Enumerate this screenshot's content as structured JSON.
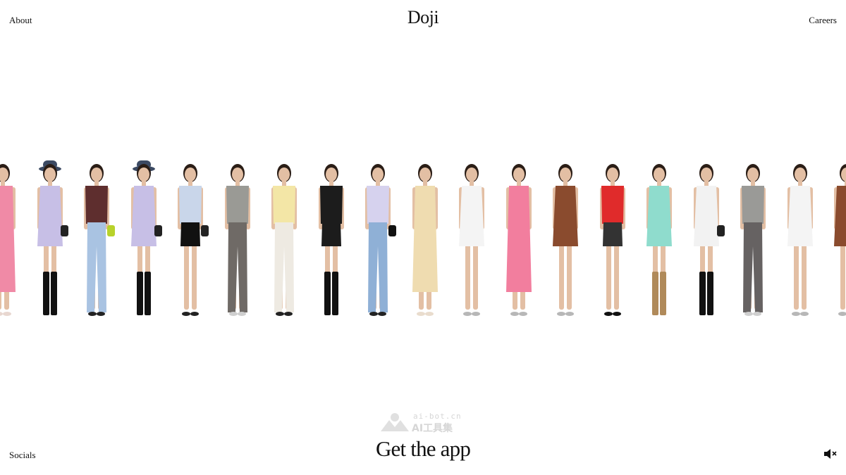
{
  "header": {
    "about_label": "About",
    "logo_text": "Doji",
    "careers_label": "Careers"
  },
  "footer": {
    "socials_label": "Socials",
    "cta_label": "Get the app",
    "mute_icon": "speaker-muted-icon"
  },
  "watermark": {
    "url": "ai-bot.cn",
    "name": "AI工具集"
  },
  "colors": {
    "background": "#ffffff",
    "text": "#111111",
    "skin": "#e3bfa4",
    "hair": "#2a1d16"
  },
  "runway": {
    "models": [
      {
        "name": "model-pink-dress-partial",
        "top": "#f08aa6",
        "bottom": "#f08aa6",
        "shoes": "#e8d7d0",
        "hat": "",
        "bag": "",
        "long_bottom": true,
        "dress": true
      },
      {
        "name": "model-lavender-dress-bucket-hat",
        "top": "#c7bfe6",
        "bottom": "#c7bfe6",
        "shoes": "#111111",
        "hat": "#3c4a63",
        "bag": "#222222",
        "long_bottom": false,
        "dress": true,
        "boots": true
      },
      {
        "name": "model-corset-jeans",
        "top": "#5e2e2e",
        "bottom": "#a9c3e2",
        "shoes": "#222222",
        "hat": "",
        "bag": "#b8d22a",
        "long_bottom": true,
        "dress": false
      },
      {
        "name": "model-lavender-dress-bucket-hat-2",
        "top": "#c7bfe6",
        "bottom": "#c7bfe6",
        "shoes": "#111111",
        "hat": "#3c4a63",
        "bag": "#222222",
        "long_bottom": false,
        "dress": true,
        "boots": true
      },
      {
        "name": "model-blue-shirt-black-shorts",
        "top": "#c9d6ea",
        "bottom": "#111111",
        "shoes": "#222222",
        "hat": "",
        "bag": "#222222",
        "long_bottom": false,
        "dress": false
      },
      {
        "name": "model-grey-top-grey-pants",
        "top": "#9a9a95",
        "bottom": "#6f6a66",
        "shoes": "#cfcfcf",
        "hat": "",
        "bag": "",
        "long_bottom": true,
        "dress": false
      },
      {
        "name": "model-yellow-top-white-pants",
        "top": "#f3e6a6",
        "bottom": "#eeeae2",
        "shoes": "#222222",
        "hat": "",
        "bag": "",
        "long_bottom": true,
        "dress": false
      },
      {
        "name": "model-leather-jacket",
        "top": "#1c1c1c",
        "bottom": "#1c1c1c",
        "shoes": "#111111",
        "hat": "",
        "bag": "",
        "long_bottom": false,
        "dress": false,
        "boots": true
      },
      {
        "name": "model-lavender-top-jeans",
        "top": "#d6d2ee",
        "bottom": "#8fb0d6",
        "shoes": "#222222",
        "hat": "",
        "bag": "#111111",
        "long_bottom": true,
        "dress": false
      },
      {
        "name": "model-cream-satin-dress",
        "top": "#efdcb0",
        "bottom": "#efdcb0",
        "shoes": "#e9dccd",
        "hat": "",
        "bag": "",
        "long_bottom": true,
        "dress": true
      },
      {
        "name": "model-white-romper",
        "top": "#f4f4f4",
        "bottom": "#f4f4f4",
        "shoes": "#b7b7b7",
        "hat": "",
        "bag": "",
        "long_bottom": false,
        "dress": true
      },
      {
        "name": "model-pink-slit-dress",
        "top": "#f27e9e",
        "bottom": "#f27e9e",
        "shoes": "#b7b7b7",
        "hat": "",
        "bag": "",
        "long_bottom": true,
        "dress": true
      },
      {
        "name": "model-brown-leather-dress",
        "top": "#8a4b2e",
        "bottom": "#8a4b2e",
        "shoes": "#b7b7b7",
        "hat": "",
        "bag": "",
        "long_bottom": false,
        "dress": true
      },
      {
        "name": "model-red-top-black-skirt",
        "top": "#e02b2b",
        "bottom": "#333333",
        "shoes": "#111111",
        "hat": "",
        "bag": "",
        "long_bottom": false,
        "dress": false
      },
      {
        "name": "model-mint-dress",
        "top": "#8fdccd",
        "bottom": "#8fdccd",
        "shoes": "#b08a5a",
        "hat": "",
        "bag": "",
        "long_bottom": false,
        "dress": true,
        "boots": true
      },
      {
        "name": "model-white-tee-dress",
        "top": "#f2f2f2",
        "bottom": "#f2f2f2",
        "shoes": "#111111",
        "hat": "",
        "bag": "#222222",
        "long_bottom": false,
        "dress": true,
        "boots": true
      },
      {
        "name": "model-grey-drape-grey-pants",
        "top": "#9a9a97",
        "bottom": "#666262",
        "shoes": "#cfcfcf",
        "hat": "",
        "bag": "",
        "long_bottom": true,
        "dress": false
      },
      {
        "name": "model-white-romper-2",
        "top": "#f4f4f4",
        "bottom": "#f4f4f4",
        "shoes": "#b7b7b7",
        "hat": "",
        "bag": "",
        "long_bottom": false,
        "dress": true
      },
      {
        "name": "model-brown-dress-partial",
        "top": "#8a4b2e",
        "bottom": "#8a4b2e",
        "shoes": "#b7b7b7",
        "hat": "",
        "bag": "",
        "long_bottom": false,
        "dress": true
      }
    ]
  }
}
